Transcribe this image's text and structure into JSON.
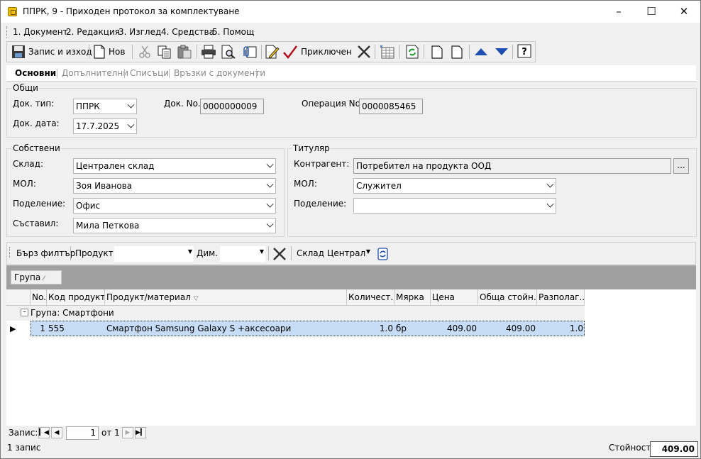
{
  "window": {
    "title": "ППРК, 9 - Приходен протокол за комплектуване"
  },
  "menu": [
    "1. Документ",
    "2. Редакция",
    "3. Изглед",
    "4. Средства",
    "5. Помощ"
  ],
  "toolbar": {
    "save_exit": "Запис и изход",
    "new": "Нов",
    "finished": "Приключен"
  },
  "tabs": [
    "Основни",
    "Допълнителни",
    "Списъци",
    "Връзки с документи"
  ],
  "general": {
    "title": "Общи",
    "doc_type_label": "Док. тип:",
    "doc_type": "ППРК",
    "doc_no_label": "Док. No.",
    "doc_no": "0000000009",
    "op_no_label": "Операция No.",
    "op_no": "0000085465",
    "doc_date_label": "Док. дата:",
    "doc_date": "17.7.2025"
  },
  "own": {
    "title": "Собствени",
    "warehouse_label": "Склад:",
    "warehouse": "Централен склад",
    "mol_label": "МОЛ:",
    "mol": "Зоя Иванова",
    "division_label": "Поделение:",
    "division": "Офис",
    "author_label": "Съставил:",
    "author": "Мила Петкова"
  },
  "holder": {
    "title": "Титуляр",
    "counterparty_label": "Контрагент:",
    "counterparty": "Потребител на продукта ООД",
    "ellipsis": "...",
    "mol_label": "МОЛ:",
    "mol": "Служител",
    "division_label": "Поделение:",
    "division": ""
  },
  "quick_filter": {
    "label": "Бърз филтър",
    "product_label": "Продукт:",
    "product": "",
    "dim_label": "Дим.",
    "dim": "",
    "warehouse_label": "Склад:",
    "warehouse": "Централ"
  },
  "group_chip": "Група",
  "table": {
    "columns": [
      "No.",
      "Код продукт...",
      "Продукт/материал",
      "Количест...",
      "Мярка",
      "Цена",
      "Обща стойн...",
      "Разполаг..."
    ],
    "group_row": "Група: Смартфони",
    "rows": [
      {
        "no": "1",
        "code": "555",
        "product": "Смартфон Samsung Galaxy S +аксесоари",
        "qty": "1.0",
        "unit": "бр",
        "price": "409.00",
        "total": "409.00",
        "avail": "1.0"
      }
    ]
  },
  "navigator": {
    "label": "Запис:",
    "current": "1",
    "of": "от 1"
  },
  "status": {
    "records": "1 запис",
    "value_label": "Стойност:",
    "value": "409.00"
  },
  "colors": {
    "selected_row": "#c7ddf7",
    "group_bar": "#a0a0a0",
    "arrow_blue": "#1c4fb0"
  }
}
